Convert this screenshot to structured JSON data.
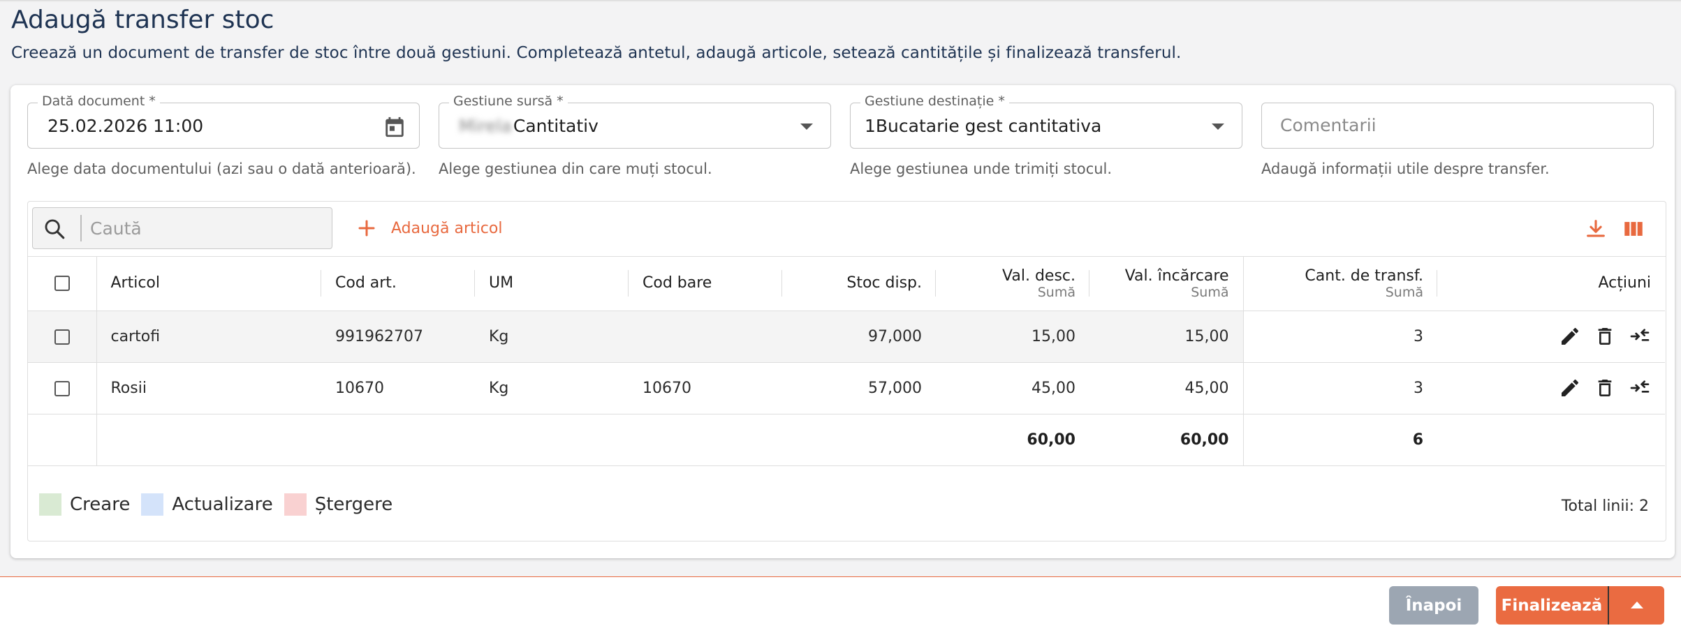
{
  "page": {
    "title": "Adaugă transfer stoc",
    "subtitle": "Creează un document de transfer de stoc între două gestiuni. Completează antetul, adaugă articole, setează cantitățile și finalizează transferul."
  },
  "form": {
    "date": {
      "label": "Dată document *",
      "value": "25.02.2026 11:00",
      "helper": "Alege data documentului (azi sau o dată anterioară).",
      "icon": "calendar-icon"
    },
    "source": {
      "label": "Gestiune sursă *",
      "value_blurred": "Mirela",
      "value": "Cantitativ",
      "helper": "Alege gestiunea din care muți stocul."
    },
    "destination": {
      "label": "Gestiune destinație *",
      "value": "1Bucatarie gest cantitativa",
      "helper": "Alege gestiunea unde trimiți stocul."
    },
    "comments": {
      "placeholder": "Comentarii",
      "helper": "Adaugă informații utile despre transfer."
    }
  },
  "toolbar": {
    "search_placeholder": "Caută",
    "add_label": "Adaugă articol",
    "accent": "#e8693f"
  },
  "table": {
    "columns": {
      "articol": "Articol",
      "cod_art": "Cod art.",
      "um": "UM",
      "cod_bare": "Cod bare",
      "stoc": "Stoc disp.",
      "val_desc": "Val. desc.",
      "val_incarcare": "Val. încărcare",
      "cant": "Cant. de transf.",
      "actiuni": "Acțiuni",
      "suma": "Sumă"
    },
    "rows": [
      {
        "articol": "cartofi",
        "cod_art": "991962707",
        "um": "Kg",
        "cod_bare": "",
        "stoc": "97,000",
        "val_desc": "15,00",
        "val_incarcare": "15,00",
        "cant": "3"
      },
      {
        "articol": "Rosii",
        "cod_art": "10670",
        "um": "Kg",
        "cod_bare": "10670",
        "stoc": "57,000",
        "val_desc": "45,00",
        "val_incarcare": "45,00",
        "cant": "3"
      }
    ],
    "totals": {
      "val_desc": "60,00",
      "val_incarcare": "60,00",
      "cant": "6"
    }
  },
  "legend": {
    "items": [
      {
        "label": "Creare",
        "color": "#d9ead3"
      },
      {
        "label": "Actualizare",
        "color": "#d4e3fa"
      },
      {
        "label": "Ștergere",
        "color": "#f9d1d1"
      }
    ],
    "total_lines": "Total linii: 2"
  },
  "footer": {
    "back_label": "Înapoi",
    "finalize_label": "Finalizează",
    "back_color": "#9ca6b2",
    "finalize_color": "#ea6b41"
  }
}
